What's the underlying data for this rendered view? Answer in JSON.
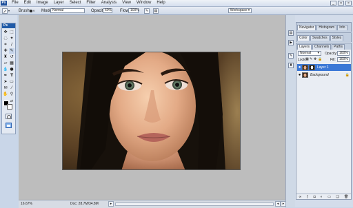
{
  "app": {
    "logo": "Ps"
  },
  "menu": {
    "items": [
      "File",
      "Edit",
      "Image",
      "Layer",
      "Select",
      "Filter",
      "Analysis",
      "View",
      "Window",
      "Help"
    ],
    "controls": [
      "_",
      "□",
      "×"
    ]
  },
  "options": {
    "brush_label": "Brush:",
    "brush_size": "9",
    "mode_label": "Mode:",
    "mode_value": "Normal",
    "opacity_label": "Opacity:",
    "opacity_value": "60%",
    "flow_label": "Flow:",
    "flow_value": "100%",
    "workspace_label": "Workspace"
  },
  "tools": {
    "panel_title": "Ps"
  },
  "panels": {
    "group1_tabs": [
      "Navigator",
      "Histogram",
      "Info"
    ],
    "group2_tabs": [
      "Color",
      "Swatches",
      "Styles"
    ],
    "layers_tabs": [
      "Layers",
      "Channels",
      "Paths"
    ],
    "blend_mode": "Normal",
    "opacity_label": "Opacity:",
    "opacity_value": "100%",
    "lock_label": "Lock:",
    "fill_label": "Fill:",
    "fill_value": "100%",
    "layers": [
      {
        "name": "Layer 1",
        "selected": true
      },
      {
        "name": "Background",
        "selected": false
      }
    ]
  },
  "status": {
    "zoom": "16.67%",
    "doc": "Doc: 28.7M/34.8M"
  },
  "colors": {
    "accent": "#3b78d6",
    "workspace": "#bdbdbd",
    "chrome": "#c9d6e8"
  }
}
